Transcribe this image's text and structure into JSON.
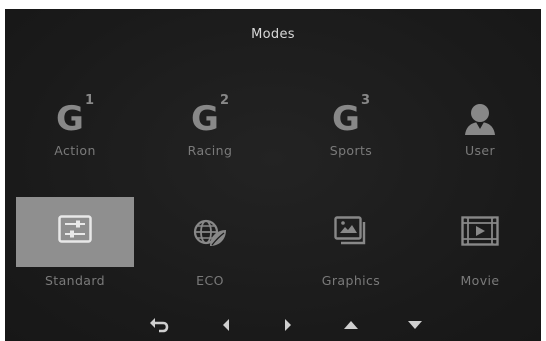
{
  "menu": {
    "title": "Modes",
    "selected": "Standard"
  },
  "modes": [
    {
      "id": "action",
      "label": "Action",
      "icon": "g1-icon",
      "badge": "1"
    },
    {
      "id": "racing",
      "label": "Racing",
      "icon": "g2-icon",
      "badge": "2"
    },
    {
      "id": "sports",
      "label": "Sports",
      "icon": "g3-icon",
      "badge": "3"
    },
    {
      "id": "user",
      "label": "User",
      "icon": "user-icon"
    },
    {
      "id": "standard",
      "label": "Standard",
      "icon": "sliders-icon"
    },
    {
      "id": "eco",
      "label": "ECO",
      "icon": "eco-globe-leaf-icon"
    },
    {
      "id": "graphics",
      "label": "Graphics",
      "icon": "picture-stack-icon"
    },
    {
      "id": "movie",
      "label": "Movie",
      "icon": "film-play-icon"
    }
  ],
  "nav": {
    "buttons": [
      "back-arrow-icon",
      "left-arrow-icon",
      "right-arrow-icon",
      "up-arrow-icon",
      "down-arrow-icon"
    ]
  },
  "colors": {
    "background": "#1c1c1c",
    "icon": "#888888",
    "label": "#7a7a7a",
    "title": "#d9d9d9",
    "selection": "#8f8f8f"
  }
}
